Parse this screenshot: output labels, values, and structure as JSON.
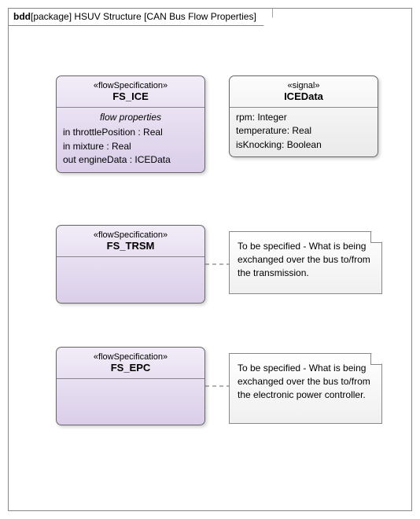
{
  "frame": {
    "kind": "bdd",
    "pkg": "[package] HSUV Structure [CAN Bus Flow Properties]"
  },
  "blocks": {
    "fs_ice": {
      "stereo": "«flowSpecification»",
      "name": "FS_ICE",
      "compartment_title": "flow properties",
      "props": [
        "in throttlePosition : Real",
        "in mixture : Real",
        "out engineData : ICEData"
      ]
    },
    "icedata": {
      "stereo": "«signal»",
      "name": "ICEData",
      "props": [
        "rpm: Integer",
        "temperature: Real",
        "isKnocking: Boolean"
      ]
    },
    "fs_trsm": {
      "stereo": "«flowSpecification»",
      "name": "FS_TRSM"
    },
    "fs_epc": {
      "stereo": "«flowSpecification»",
      "name": "FS_EPC"
    }
  },
  "notes": {
    "trsm": "To be specified - What is being exchanged over the bus to/from the transmission.",
    "epc": "To be specified - What is being exchanged over the bus to/from the electronic power controller."
  }
}
